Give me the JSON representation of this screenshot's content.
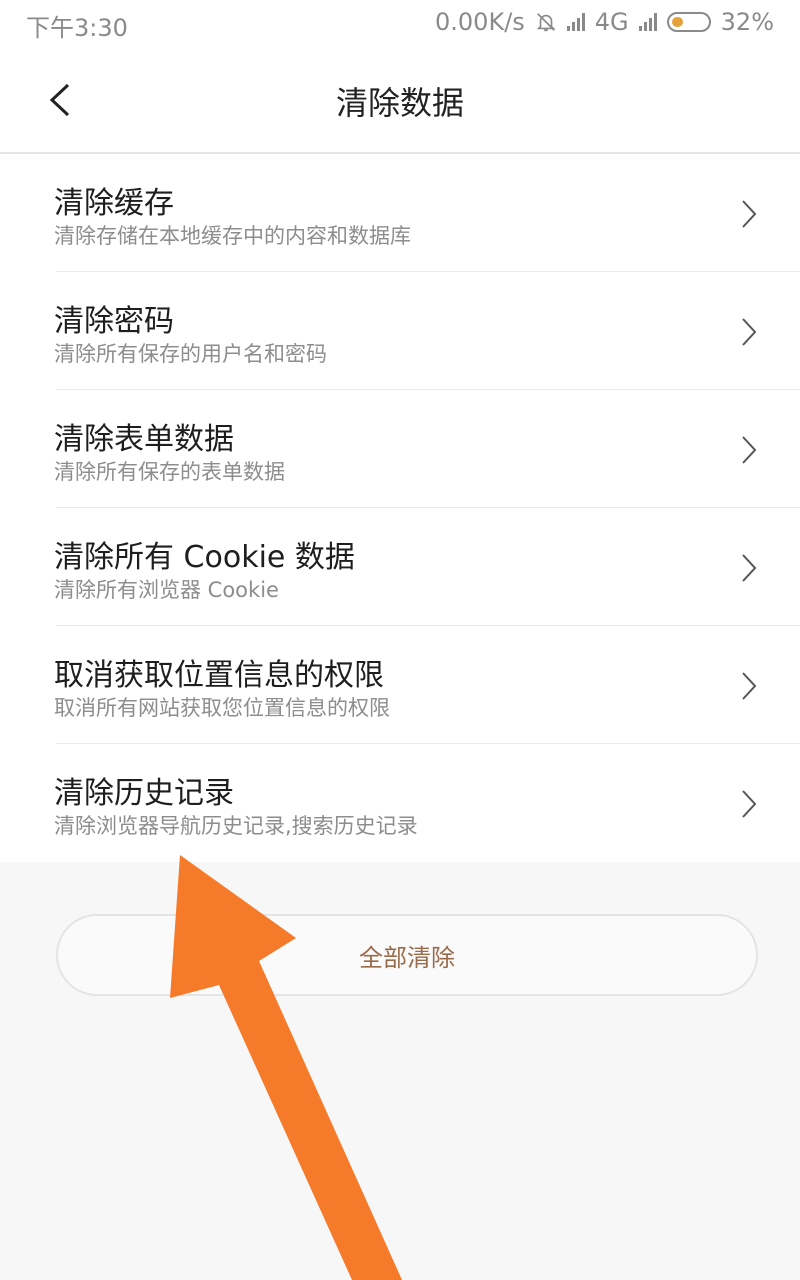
{
  "status_bar": {
    "time": "下午3:30",
    "network_speed": "0.00K/s",
    "network_type": "4G",
    "battery": "32%",
    "battery_level": 0.32
  },
  "header": {
    "title": "清除数据"
  },
  "items": [
    {
      "title": "清除缓存",
      "subtitle": "清除存储在本地缓存中的内容和数据库"
    },
    {
      "title": "清除密码",
      "subtitle": "清除所有保存的用户名和密码"
    },
    {
      "title": "清除表单数据",
      "subtitle": "清除所有保存的表单数据"
    },
    {
      "title": "清除所有 Cookie 数据",
      "subtitle": "清除所有浏览器 Cookie"
    },
    {
      "title": "取消获取位置信息的权限",
      "subtitle": "取消所有网站获取您位置信息的权限"
    },
    {
      "title": "清除历史记录",
      "subtitle": "清除浏览器导航历史记录,搜索历史记录"
    }
  ],
  "actions": {
    "clear_all": "全部清除"
  },
  "colors": {
    "accent_text": "#9a6b4a",
    "annotation_arrow": "#f57a2a"
  }
}
